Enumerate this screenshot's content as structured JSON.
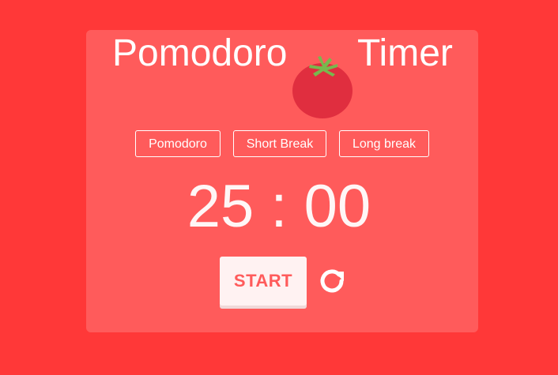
{
  "title": {
    "left": "Pomodoro",
    "right": "Timer",
    "icon": "tomato-icon"
  },
  "modes": [
    {
      "label": "Pomodoro"
    },
    {
      "label": "Short Break"
    },
    {
      "label": "Long break"
    }
  ],
  "timer": {
    "display": "25 : 00"
  },
  "controls": {
    "start_label": "START",
    "reset_icon": "reset-icon"
  },
  "colors": {
    "background": "#ff3838",
    "card": "#ff5b5b",
    "tomato": "#e02e3f",
    "leaf": "#78b84e",
    "text": "#ffffff"
  }
}
